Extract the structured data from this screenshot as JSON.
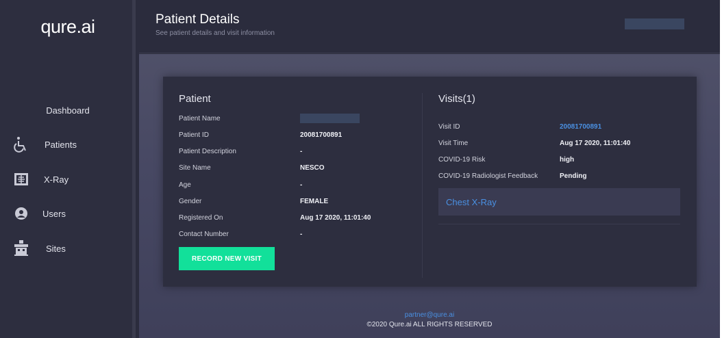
{
  "brand": {
    "logo_text": "qure.ai"
  },
  "sidebar": {
    "dashboard_label": "Dashboard",
    "items": [
      {
        "label": "Patients",
        "icon": "wheelchair-icon"
      },
      {
        "label": "X-Ray",
        "icon": "xray-icon"
      },
      {
        "label": "Users",
        "icon": "user-icon"
      },
      {
        "label": "Sites",
        "icon": "building-icon"
      }
    ]
  },
  "header": {
    "title": "Patient Details",
    "subtitle": "See patient details and visit information"
  },
  "patient": {
    "section_title": "Patient",
    "fields": [
      {
        "label": "Patient Name",
        "value": ""
      },
      {
        "label": "Patient ID",
        "value": "20081700891"
      },
      {
        "label": "Patient Description",
        "value": "-"
      },
      {
        "label": "Site Name",
        "value": "NESCO"
      },
      {
        "label": "Age",
        "value": "-"
      },
      {
        "label": "Gender",
        "value": "FEMALE"
      },
      {
        "label": "Registered On",
        "value": "Aug 17 2020, 11:01:40"
      },
      {
        "label": "Contact Number",
        "value": "-"
      }
    ],
    "record_button_label": "RECORD NEW VISIT"
  },
  "visits": {
    "section_title": "Visits(1)",
    "fields": [
      {
        "label": "Visit ID",
        "value": "20081700891"
      },
      {
        "label": "Visit Time",
        "value": "Aug 17 2020, 11:01:40"
      },
      {
        "label": "COVID-19 Risk",
        "value": "high"
      },
      {
        "label": "COVID-19 Radiologist Feedback",
        "value": "Pending"
      }
    ],
    "chest_xray_label": "Chest X-Ray"
  },
  "footer": {
    "email": "partner@qure.ai",
    "copyright": "©2020 Qure.ai ALL RIGHTS RESERVED"
  },
  "colors": {
    "accent": "#12e09a",
    "link": "#4a90e2",
    "sidebar_bg": "#2d2e3f",
    "card_bg": "#2d2e3f"
  }
}
